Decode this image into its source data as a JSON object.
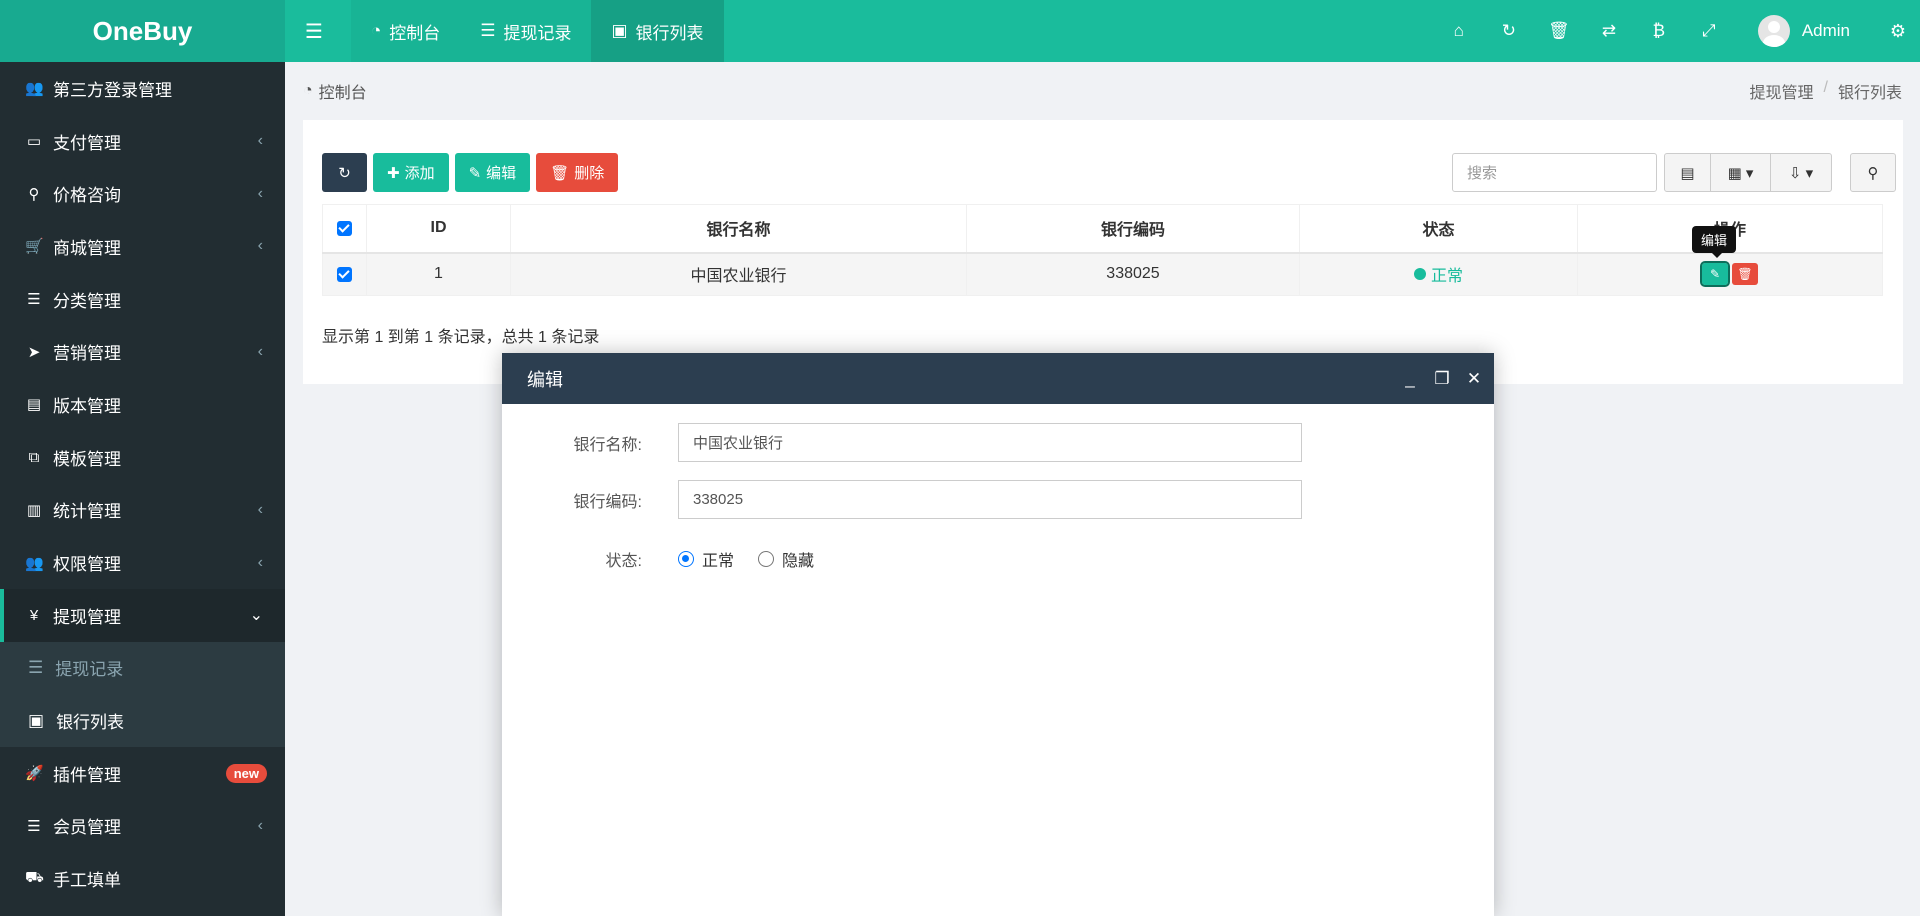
{
  "app": {
    "logo": "OneBuy"
  },
  "topnav": {
    "tabs": [
      {
        "icon": "dashboard-icon",
        "label": "控制台"
      },
      {
        "icon": "list-icon",
        "label": "提现记录"
      },
      {
        "icon": "cc-icon",
        "label": "银行列表"
      }
    ],
    "user": "Admin"
  },
  "sidebar": {
    "items": [
      {
        "label": "第三方登录管理",
        "icon": "users-icon"
      },
      {
        "label": "支付管理",
        "icon": "credit-card-icon"
      },
      {
        "label": "价格咨询",
        "icon": "search-icon"
      },
      {
        "label": "商城管理",
        "icon": "cart-icon"
      },
      {
        "label": "分类管理",
        "icon": "list-icon"
      },
      {
        "label": "营销管理",
        "icon": "send-icon"
      },
      {
        "label": "版本管理",
        "icon": "file-icon"
      },
      {
        "label": "模板管理",
        "icon": "clone-icon"
      },
      {
        "label": "统计管理",
        "icon": "bar-chart-icon"
      },
      {
        "label": "权限管理",
        "icon": "users-icon"
      },
      {
        "label": "提现管理",
        "icon": "yen-icon"
      },
      {
        "label": "插件管理",
        "icon": "rocket-icon",
        "badge": "new"
      },
      {
        "label": "会员管理",
        "icon": "list-icon"
      },
      {
        "label": "手工填单",
        "icon": "truck-icon"
      }
    ],
    "submenu": [
      {
        "label": "提现记录",
        "icon": "list-icon"
      },
      {
        "label": "银行列表",
        "icon": "cc-icon"
      }
    ]
  },
  "breadcrumb": {
    "left": "控制台",
    "right": [
      "提现管理",
      "银行列表"
    ],
    "separator": "/"
  },
  "toolbar": {
    "add": "添加",
    "edit": "编辑",
    "delete": "删除",
    "search_placeholder": "搜索"
  },
  "table": {
    "columns": [
      "ID",
      "银行名称",
      "银行编码",
      "状态",
      "操作"
    ],
    "rows": [
      {
        "id": "1",
        "name": "中国农业银行",
        "code": "338025",
        "status": "正常"
      }
    ],
    "tooltip": "编辑",
    "summary": "显示第 1 到第 1 条记录，总共 1 条记录"
  },
  "modal": {
    "title": "编辑",
    "fields": {
      "name_label": "银行名称:",
      "name_value": "中国农业银行",
      "code_label": "银行编码:",
      "code_value": "338025",
      "status_label": "状态:",
      "status_options": [
        "正常",
        "隐藏"
      ],
      "status_selected": "正常"
    }
  },
  "colors": {
    "accent": "#1abc9c",
    "sidebar_bg": "#222d32",
    "danger": "#e74c3c",
    "dark": "#2c3e50"
  }
}
